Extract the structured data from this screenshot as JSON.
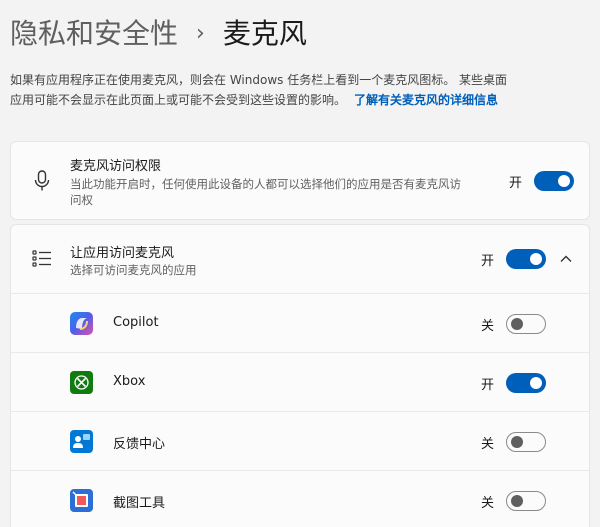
{
  "breadcrumb": {
    "parent": "隐私和安全性",
    "separator": "›",
    "current": "麦克风"
  },
  "description": {
    "line1": "如果有应用程序正在使用麦克风，则会在 Windows 任务栏上看到一个麦克风图标。 某些桌面",
    "line2": "应用可能不会显示在此页面上或可能不会受到这些设置的影响。",
    "link": "了解有关麦克风的详细信息"
  },
  "mic_access": {
    "icon": "microphone-icon",
    "title": "麦克风访问权限",
    "subtitle_line1": "当此功能开启时，任何使用此设备的人都可以选择他们的应用是否有麦克风访",
    "subtitle_line2": "问权",
    "toggle_label": "开",
    "toggle_on": true
  },
  "app_access": {
    "icon": "list-icon",
    "title": "让应用访问麦克风",
    "subtitle": "选择可访问麦克风的应用",
    "toggle_label": "开",
    "toggle_on": true,
    "expand_icon": "chevron-up-icon"
  },
  "apps": [
    {
      "name": "Copilot",
      "toggle_label": "关",
      "toggle_on": false,
      "icon": "copilot-icon",
      "color": "#3b82f6"
    },
    {
      "name": "Xbox",
      "toggle_label": "开",
      "toggle_on": true,
      "icon": "xbox-icon",
      "color": "#107c10"
    },
    {
      "name": "反馈中心",
      "toggle_label": "关",
      "toggle_on": false,
      "icon": "feedback-hub-icon",
      "color": "#0078d4"
    },
    {
      "name": "截图工具",
      "toggle_label": "关",
      "toggle_on": false,
      "icon": "snipping-tool-icon",
      "color": "#2b6fd6"
    }
  ],
  "colors": {
    "accent": "#005fb8",
    "background": "#f3f3f3",
    "card": "#fbfbfb"
  }
}
